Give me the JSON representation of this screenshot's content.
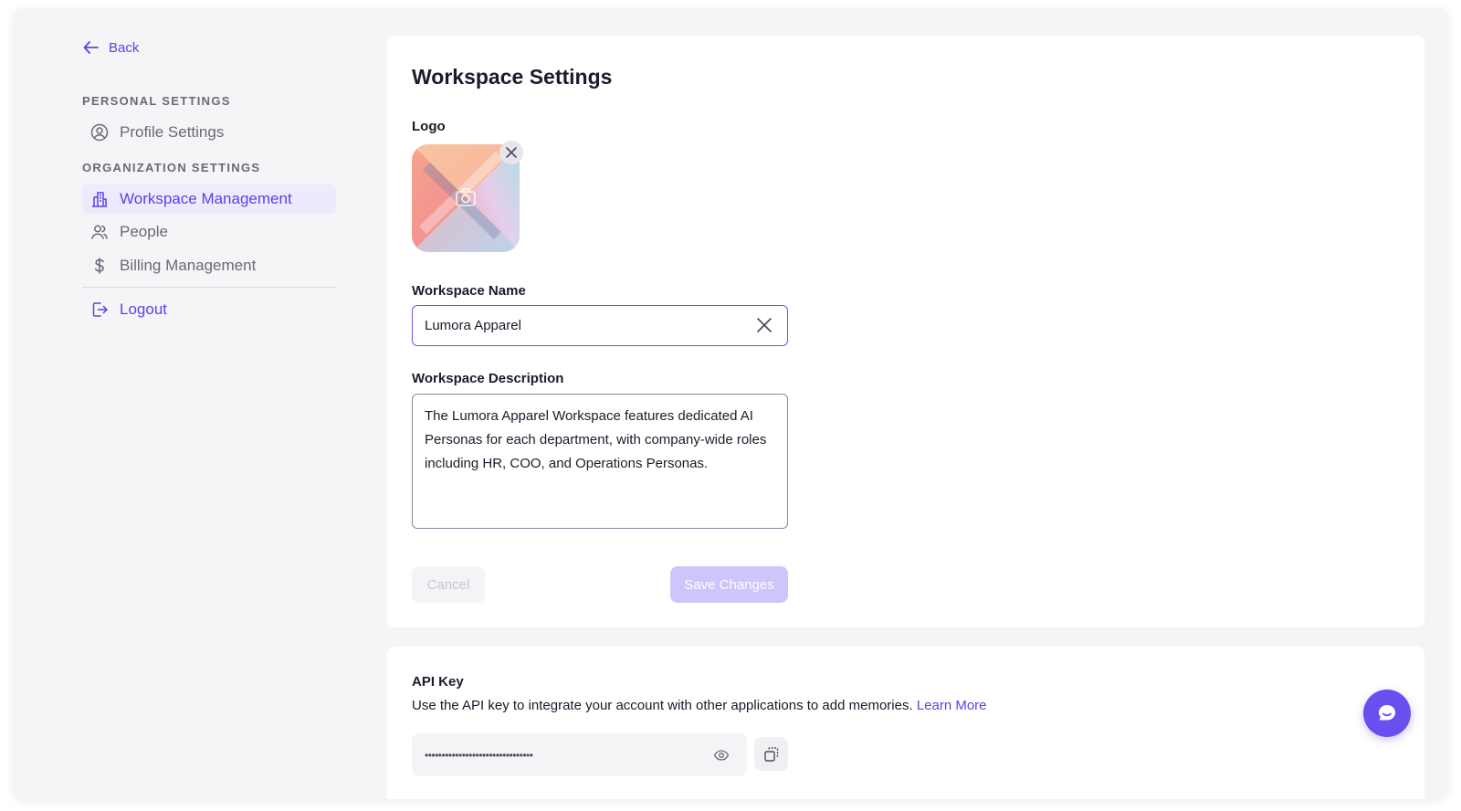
{
  "sidebar": {
    "back_label": "Back",
    "personal_section": "PERSONAL SETTINGS",
    "org_section": "ORGANIZATION SETTINGS",
    "items": [
      {
        "label": "Profile Settings",
        "icon": "user-circle-icon"
      },
      {
        "label": "Workspace Management",
        "icon": "building-icon",
        "active": true
      },
      {
        "label": "People",
        "icon": "people-icon"
      },
      {
        "label": "Billing Management",
        "icon": "dollar-icon"
      }
    ],
    "logout_label": "Logout"
  },
  "workspace": {
    "title": "Workspace Settings",
    "logo_label": "Logo",
    "name_label": "Workspace Name",
    "name_value": "Lumora Apparel",
    "description_label": "Workspace Description",
    "description_value": "The Lumora Apparel Workspace features dedicated AI Personas for each department, with company-wide roles including HR, COO, and Operations Personas.",
    "cancel_label": "Cancel",
    "save_label": "Save Changes"
  },
  "api": {
    "title": "API Key",
    "description": "Use the API key to integrate your account with other applications to add memories.",
    "learn_more": "Learn More",
    "masked_key": "••••••••••••••••••••••••••••••••"
  },
  "colors": {
    "accent": "#5b42e8",
    "active_bg": "#ecebfd",
    "save_disabled": "#cdc6fb",
    "fab": "#6a4ff0"
  }
}
